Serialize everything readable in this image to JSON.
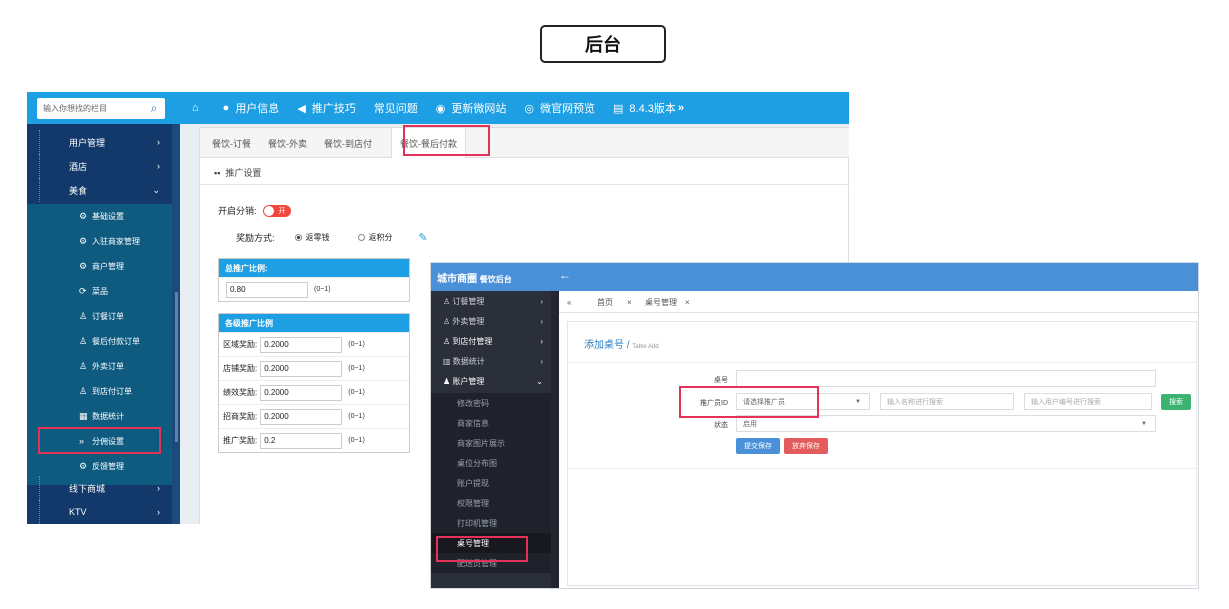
{
  "header": {
    "label": "后台"
  },
  "admin1": {
    "search_placeholder": "输入你想找的栏目",
    "nav": [
      {
        "icon": "home-icon",
        "label": ""
      },
      {
        "icon": "user-icon",
        "label": "用户信息"
      },
      {
        "icon": "megaphone-icon",
        "label": "推广技巧"
      },
      {
        "icon": "",
        "label": "常见问题"
      },
      {
        "icon": "globe-icon",
        "label": "更新微网站"
      },
      {
        "icon": "eye-icon",
        "label": "微官网预览"
      },
      {
        "icon": "document-icon",
        "label": "8.4.3版本"
      }
    ],
    "sidebar": {
      "top": [
        {
          "label": "用户管理",
          "chev": "›"
        },
        {
          "label": "酒店",
          "chev": "›"
        },
        {
          "label": "美食",
          "chev": "⌄"
        }
      ],
      "sub": [
        {
          "label": "基础设置",
          "icon": "⚙"
        },
        {
          "label": "入驻商家管理",
          "icon": "⚙"
        },
        {
          "label": "商户管理",
          "icon": "⚙"
        },
        {
          "label": "菜品",
          "icon": "⟳"
        },
        {
          "label": "订餐订单",
          "icon": "♙"
        },
        {
          "label": "餐后付款订单",
          "icon": "♙"
        },
        {
          "label": "外卖订单",
          "icon": "♙"
        },
        {
          "label": "到店付订单",
          "icon": "♙"
        },
        {
          "label": "数据统计",
          "icon": "▦"
        },
        {
          "label": "分佣设置",
          "icon": "»"
        },
        {
          "label": "反馈管理",
          "icon": "⚙"
        }
      ],
      "bottom": [
        {
          "label": "线下商城",
          "chev": "›"
        },
        {
          "label": "KTV",
          "chev": "›"
        }
      ]
    },
    "tabs": [
      "餐饮-订餐",
      "餐饮-外卖",
      "餐饮-到店付",
      "餐饮-餐后付款"
    ],
    "section_title": "推广设置",
    "toggle_label": "开启分销:",
    "toggle_value": "开",
    "reward_label": "奖励方式:",
    "reward_options": [
      "返零钱",
      "返积分"
    ],
    "total_ratio": {
      "title": "总推广比例:",
      "value": "0.80",
      "hint": "(0~1)"
    },
    "levels": {
      "title": "各级推广比例",
      "rows": [
        {
          "label": "区域奖励:",
          "value": "0.2000",
          "hint": "(0~1)"
        },
        {
          "label": "店铺奖励:",
          "value": "0.2000",
          "hint": "(0~1)"
        },
        {
          "label": "绩效奖励:",
          "value": "0.2000",
          "hint": "(0~1)"
        },
        {
          "label": "招商奖励:",
          "value": "0.2000",
          "hint": "(0~1)"
        },
        {
          "label": "推广奖励:",
          "value": "0.2",
          "hint": "(0~1)"
        }
      ]
    }
  },
  "admin2": {
    "brand": "城市商圈",
    "brand_sub": "餐饮后台",
    "back": "←",
    "sidebar": {
      "top": [
        {
          "label": "订餐管理",
          "chev": "›"
        },
        {
          "label": "外卖管理",
          "chev": "›"
        },
        {
          "label": "到店付管理",
          "chev": "›"
        },
        {
          "label": "数据统计",
          "chev": "›"
        },
        {
          "label": "账户管理",
          "chev": "⌄"
        }
      ],
      "sub": [
        "修改密码",
        "商家信息",
        "商家图片展示",
        "桌位分布图",
        "账户提现",
        "权限管理",
        "打印机管理",
        "桌号管理",
        "配送员管理"
      ]
    },
    "tabs": {
      "collapse": "«",
      "home": "首页",
      "close1": "×",
      "current": "桌号管理",
      "close2": "×"
    },
    "title": "添加桌号",
    "title_sub": "Table Add",
    "form": {
      "table_label": "桌号",
      "promoter_label": "推广员ID",
      "promoter_placeholder": "请选择推广员",
      "name_search_placeholder": "输入名称进行搜索",
      "user_search_placeholder": "输入用户编号进行搜索",
      "search_button": "搜索",
      "status_label": "状态",
      "status_value": "启用",
      "submit_button": "提交保存",
      "discard_button": "放弃保存"
    }
  }
}
